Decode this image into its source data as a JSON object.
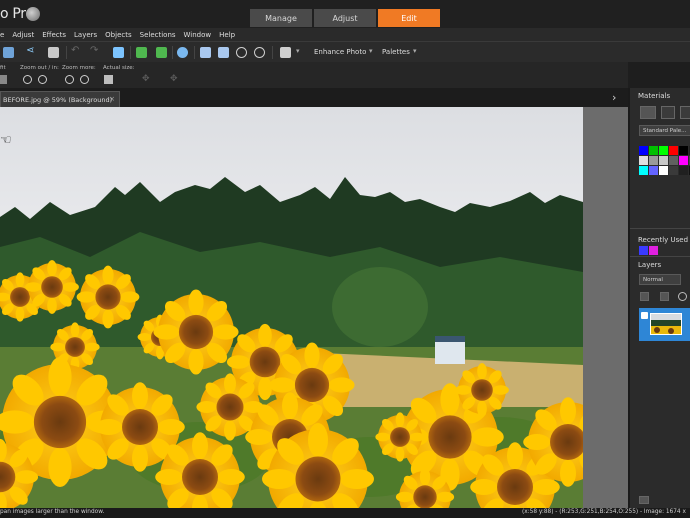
{
  "app": {
    "title": "o Pro"
  },
  "mode_tabs": [
    {
      "label": "Manage"
    },
    {
      "label": "Adjust"
    },
    {
      "label": "Edit"
    }
  ],
  "menu": [
    "e",
    "Adjust",
    "Effects",
    "Layers",
    "Objects",
    "Selections",
    "Window",
    "Help"
  ],
  "toolbar": {
    "enhance_photo": "Enhance Photo",
    "palettes": "Palettes"
  },
  "toolbar2": {
    "label_fit": "fit",
    "label_zoom_out_in": "Zoom out / in:",
    "label_zoom_more": "Zoom more:",
    "label_actual_size": "Actual size:"
  },
  "document": {
    "tab_title": "BEFORE.jpg @  59% (Background)",
    "close": "×"
  },
  "panels": {
    "materials": "Materials",
    "palette_name": "Standard Pale...",
    "recently_used": "Recently Used",
    "layers": "Layers",
    "blend_mode": "Normal"
  },
  "swatches": [
    "#0000ff",
    "#00c000",
    "#00ff00",
    "#ff0000",
    "#000000",
    "#202020",
    "#e0e0e0",
    "#9a9a9a",
    "#c8c8c8",
    "#606060",
    "#ff00ff",
    "#4a4a4a",
    "#00ffff",
    "#6464ff",
    "#ffffff",
    "#3a3a3a",
    "#202020",
    "#101010"
  ],
  "recent_swatches": [
    "#3a3aff",
    "#e020e0"
  ],
  "status": {
    "left": "pan images larger than the window.",
    "right": "(x:58 y:88) - (R:253,G:251,B:254,O:255) - Image: 1674 x"
  },
  "colors": {
    "accent": "#f07a24",
    "layer_selected": "#2e86d6"
  }
}
